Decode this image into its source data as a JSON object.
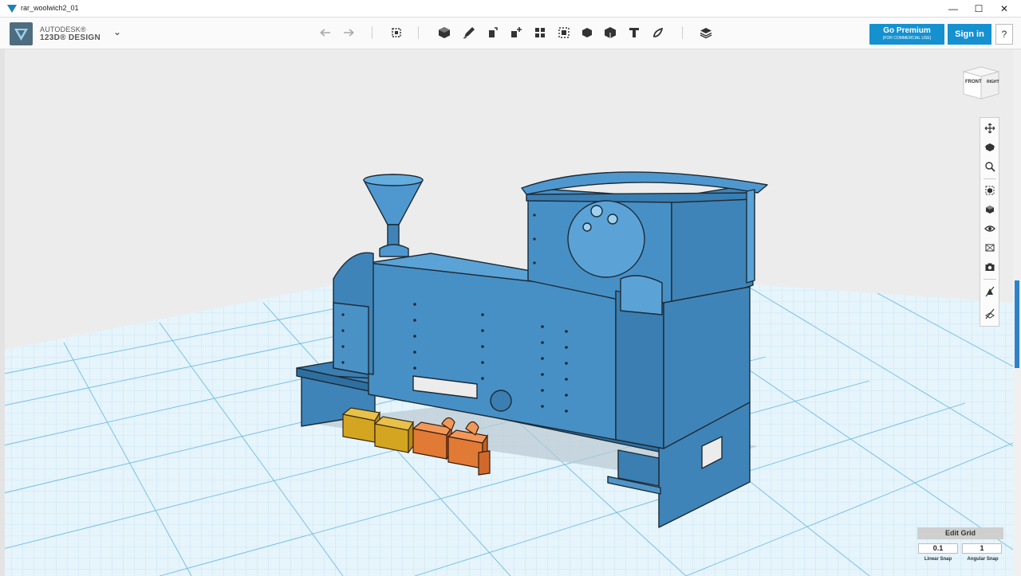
{
  "window": {
    "title": "rar_woolwich2_01",
    "minimize_glyph": "—",
    "maximize_glyph": "☐",
    "close_glyph": "✕"
  },
  "app": {
    "brand_line1": "AUTODESK®",
    "brand_line2": "123D® DESIGN",
    "menu_chevron": "⌄"
  },
  "toolbar": {
    "tools": [
      "undo-icon",
      "redo-icon",
      "transform-icon",
      "primitives-icon",
      "sketch-icon",
      "construct-icon",
      "modify-icon",
      "pattern-icon",
      "grouping-icon",
      "combine-icon",
      "measure-icon",
      "text-icon",
      "snap-icon",
      "material-icon"
    ]
  },
  "account": {
    "premium_label": "Go Premium",
    "premium_sub": "(FOR COMMERCIAL USE)",
    "signin_label": "Sign in",
    "help_label": "?"
  },
  "viewcube": {
    "front_label": "FRONT",
    "right_label": "RIGHT"
  },
  "nav": {
    "tools": [
      "pan-icon",
      "orbit-icon",
      "zoom-icon",
      "fit-icon",
      "views-icon",
      "visibility-icon",
      "materials-icon",
      "camera-icon",
      "snap-toggle-icon",
      "grid-toggle-icon"
    ]
  },
  "grid": {
    "edit_label": "Edit Grid",
    "linear_value": "0.1",
    "angular_value": "1",
    "linear_label": "Linear Snap",
    "angular_label": "Angular Snap"
  },
  "colors": {
    "model": "#3f84b8",
    "model_dark": "#2f6f9f",
    "accent": "#1591d0",
    "grid_line": "#7fc4e6",
    "yellow_part": "#d4a520",
    "orange_part": "#e07a35"
  }
}
